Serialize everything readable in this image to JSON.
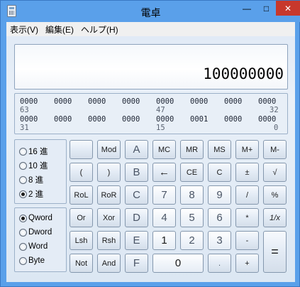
{
  "window": {
    "title": "電卓",
    "minimize": "—",
    "maximize": "□",
    "close": "✕"
  },
  "menu": [
    "表示(V)",
    "編集(E)",
    "ヘルプ(H)"
  ],
  "display": {
    "value": "100000000"
  },
  "bits": {
    "row1": [
      "0000",
      "0000",
      "0000",
      "0000",
      "0000",
      "0000",
      "0000",
      "0000"
    ],
    "row1_pos": [
      "63",
      "47",
      "32"
    ],
    "row2": [
      "0000",
      "0000",
      "0000",
      "0000",
      "0000",
      "0001",
      "0000",
      "0000"
    ],
    "row2_pos": [
      "31",
      "15",
      "0"
    ]
  },
  "base": {
    "options": [
      "16 進",
      "10 進",
      "8 進",
      "2 進"
    ],
    "selected": "2 進"
  },
  "word_size": {
    "options": [
      "Qword",
      "Dword",
      "Word",
      "Byte"
    ],
    "selected": "Qword"
  },
  "keys": {
    "r1": [
      "",
      "Mod",
      "A",
      "MC",
      "MR",
      "MS",
      "M+",
      "M-"
    ],
    "r2": [
      "(",
      ")",
      "B",
      "←",
      "CE",
      "C",
      "±",
      "√"
    ],
    "r3": [
      "RoL",
      "RoR",
      "C",
      "7",
      "8",
      "9",
      "/",
      "%"
    ],
    "r4": [
      "Or",
      "Xor",
      "D",
      "4",
      "5",
      "6",
      "*",
      "1/x"
    ],
    "r5": [
      "Lsh",
      "Rsh",
      "E",
      "1",
      "2",
      "3",
      "-",
      "="
    ],
    "r6": [
      "Not",
      "And",
      "F",
      "0",
      ".",
      "+"
    ]
  }
}
